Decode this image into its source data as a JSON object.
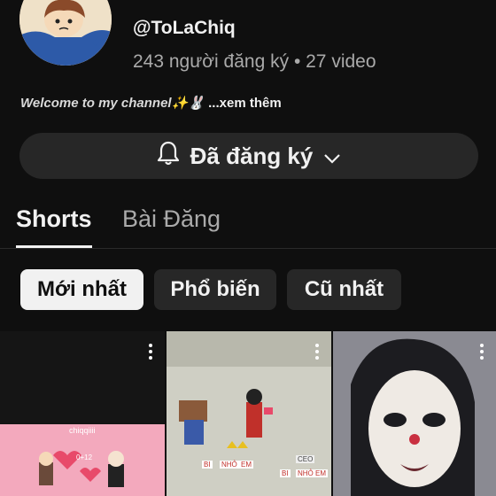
{
  "channel": {
    "handle": "@ToLaChiq",
    "stats": "243 người đăng ký • 27 video",
    "description": "Welcome to my channel✨🐰",
    "more_label": "...xem thêm"
  },
  "subscribe": {
    "label": "Đã đăng ký",
    "bell_icon": "bell-icon",
    "chevron_icon": "chevron-down-icon"
  },
  "tabs": [
    {
      "label": "Shorts",
      "active": true
    },
    {
      "label": "Bài Đăng",
      "active": false
    }
  ],
  "filters": [
    {
      "label": "Mới nhất",
      "selected": true
    },
    {
      "label": "Phổ biến",
      "selected": false
    },
    {
      "label": "Cũ nhất",
      "selected": false
    }
  ],
  "shorts": [
    {
      "caption_top": "chiqqiiii",
      "badge": "0+12"
    },
    {
      "badges": [
        "BI",
        "NHỎ",
        "EM",
        "CEO",
        "BI",
        "NHỎ",
        "EM"
      ]
    },
    {
      "menu_icon": "more-vert-icon"
    }
  ],
  "colors": {
    "background": "#0f0f0f",
    "chip_selected": "#f1f1f1",
    "chip": "#272727",
    "text_secondary": "#aaaaaa"
  }
}
